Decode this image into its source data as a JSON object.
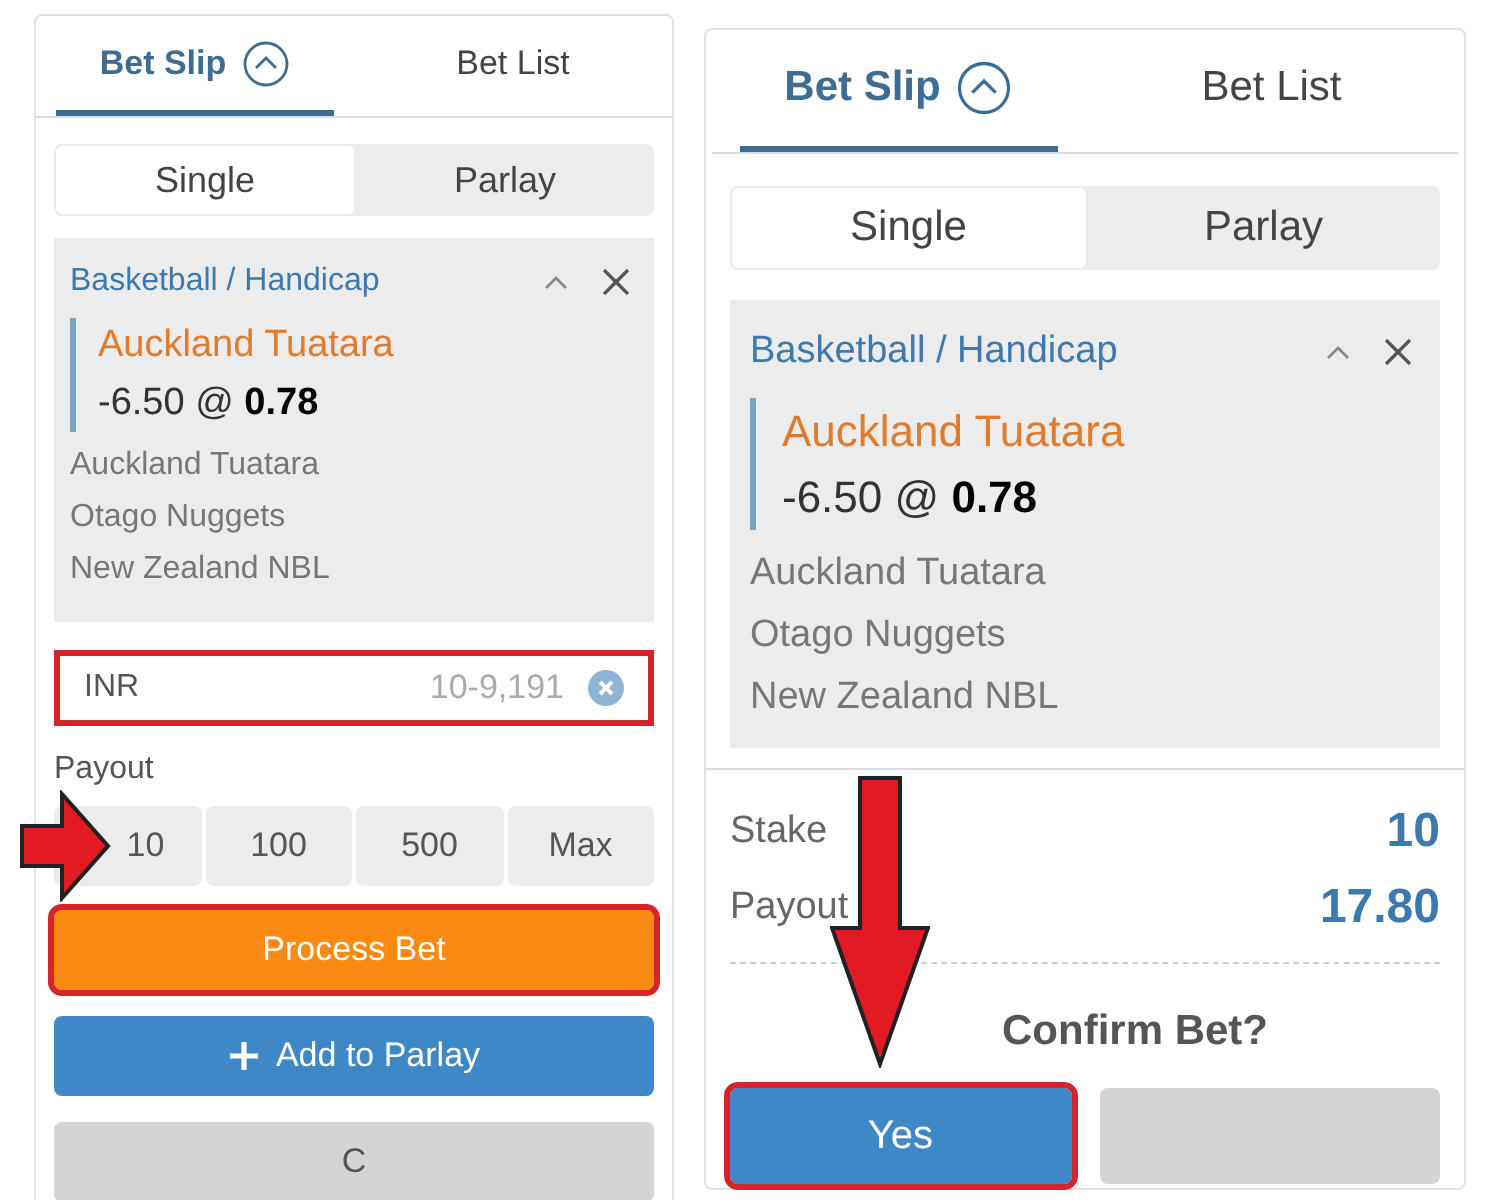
{
  "panels": [
    {
      "kind": "entry",
      "tabs": [
        {
          "label": "Bet Slip",
          "selected": true,
          "collapse_toggle": true
        },
        {
          "label": "Bet List",
          "selected": false
        }
      ],
      "modes": [
        {
          "label": "Single",
          "selected": true
        },
        {
          "label": "Parlay",
          "selected": false
        }
      ],
      "selection": {
        "market": "Basketball / Handicap",
        "team": "Auckland Tuatara",
        "line": "-6.50 @ ",
        "odds": "0.78",
        "details": [
          "Auckland Tuatara",
          "Otago Nuggets",
          "New Zealand NBL"
        ]
      },
      "stake_field": {
        "currency": "INR",
        "placeholder": "10-9,191",
        "highlighted": true
      },
      "payout_label": "Payout",
      "quick_amounts": [
        {
          "label": "10",
          "pointed": true
        },
        {
          "label": "100",
          "pointed": false
        },
        {
          "label": "500",
          "pointed": false
        },
        {
          "label": "Max",
          "pointed": false
        }
      ],
      "buttons": [
        {
          "kind": "primary",
          "label": "Process Bet",
          "highlighted": true,
          "pointed": false
        },
        {
          "kind": "add",
          "label": "Add to Parlay",
          "highlighted": false,
          "pointed": false
        },
        {
          "kind": "secondary",
          "label": "C",
          "highlighted": false,
          "pointed": false
        }
      ]
    },
    {
      "kind": "confirm",
      "tabs": [
        {
          "label": "Bet Slip",
          "selected": true,
          "collapse_toggle": true
        },
        {
          "label": "Bet List",
          "selected": false
        }
      ],
      "modes": [
        {
          "label": "Single",
          "selected": true
        },
        {
          "label": "Parlay",
          "selected": false
        }
      ],
      "selection": {
        "market": "Basketball / Handicap",
        "team": "Auckland Tuatara",
        "line": "-6.50 @ ",
        "odds": "0.78",
        "details": [
          "Auckland Tuatara",
          "Otago Nuggets",
          "New Zealand NBL"
        ]
      },
      "summary": [
        {
          "label": "Stake",
          "value": "10"
        },
        {
          "label": "Payout",
          "value": "17.80"
        }
      ],
      "confirm_prompt": "Confirm Bet?",
      "buttons": [
        {
          "kind": "confirm",
          "label": "Yes",
          "highlighted": true,
          "pointed": true
        },
        {
          "kind": "secondary",
          "highlighted": false,
          "pointed": false
        }
      ]
    }
  ]
}
